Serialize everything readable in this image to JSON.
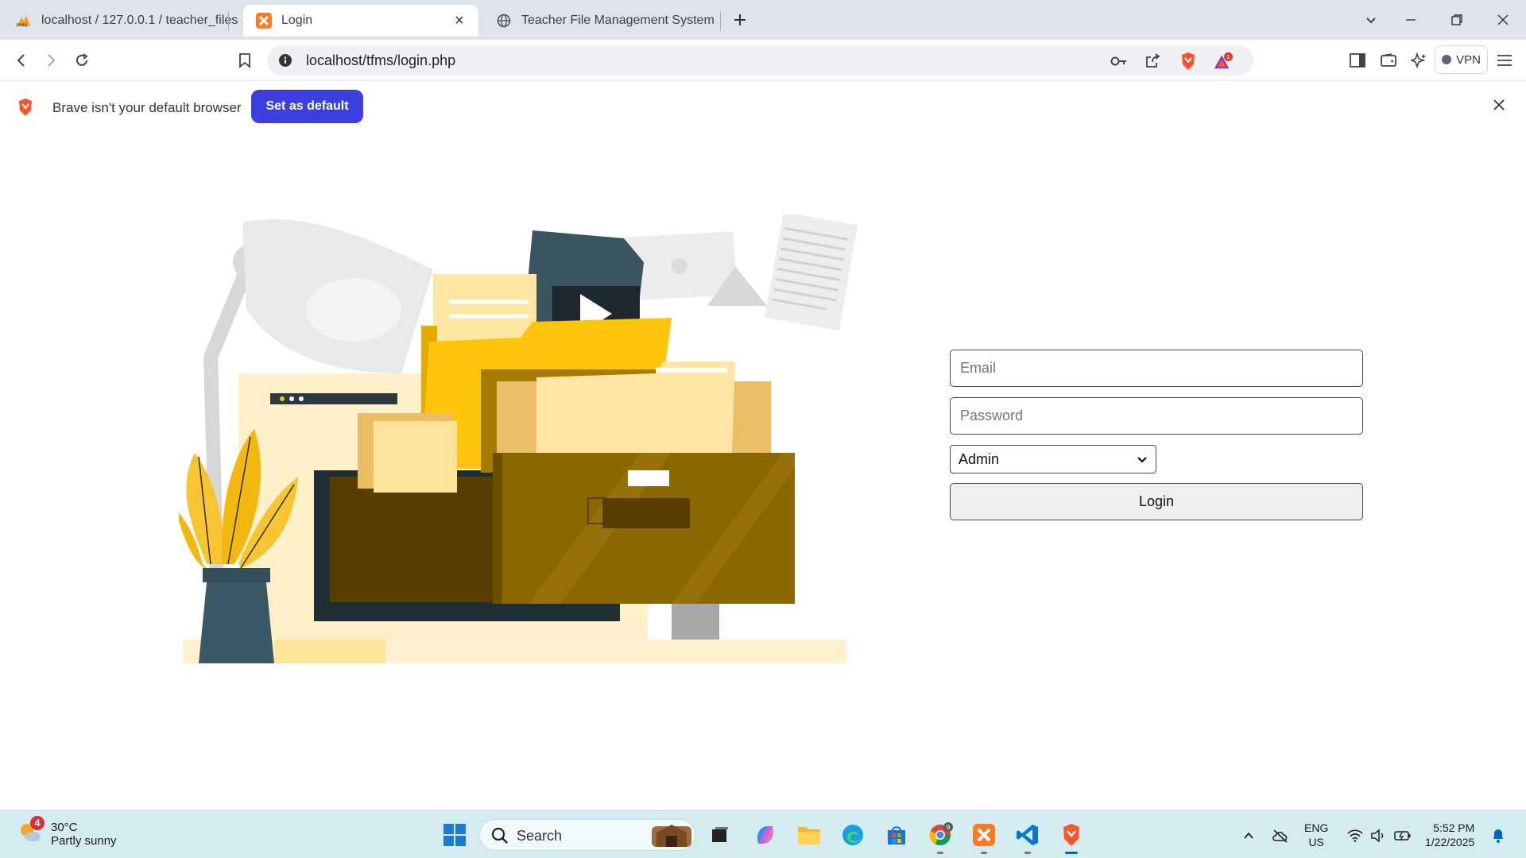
{
  "browser": {
    "tabs": [
      {
        "label": "localhost / 127.0.0.1 / teacher_files /",
        "icon": "phpmyadmin-icon",
        "active": false
      },
      {
        "label": "Login",
        "icon": "xampp-icon",
        "active": true
      },
      {
        "label": "Teacher File Management System",
        "icon": "globe-icon",
        "active": false
      }
    ],
    "url": "localhost/tfms/login.php",
    "shields_count": "1",
    "vpn_label": "VPN"
  },
  "infobar": {
    "message": "Brave isn't your default browser",
    "button_label": "Set as default"
  },
  "login": {
    "email_placeholder": "Email",
    "password_placeholder": "Password",
    "role_selected": "Admin",
    "button_label": "Login"
  },
  "taskbar": {
    "weather_badge": "4",
    "temperature": "30°C",
    "condition": "Partly sunny",
    "search_label": "Search",
    "chrome_badge": "9",
    "language_line1": "ENG",
    "language_line2": "US",
    "time": "5:52 PM",
    "date": "1/22/2025"
  },
  "colors": {
    "accent": "#3d3ee0",
    "folder_yellow": "#ffc50d",
    "drawer_brown": "#8a6700",
    "taskbar_bg": "#d4ecef"
  }
}
